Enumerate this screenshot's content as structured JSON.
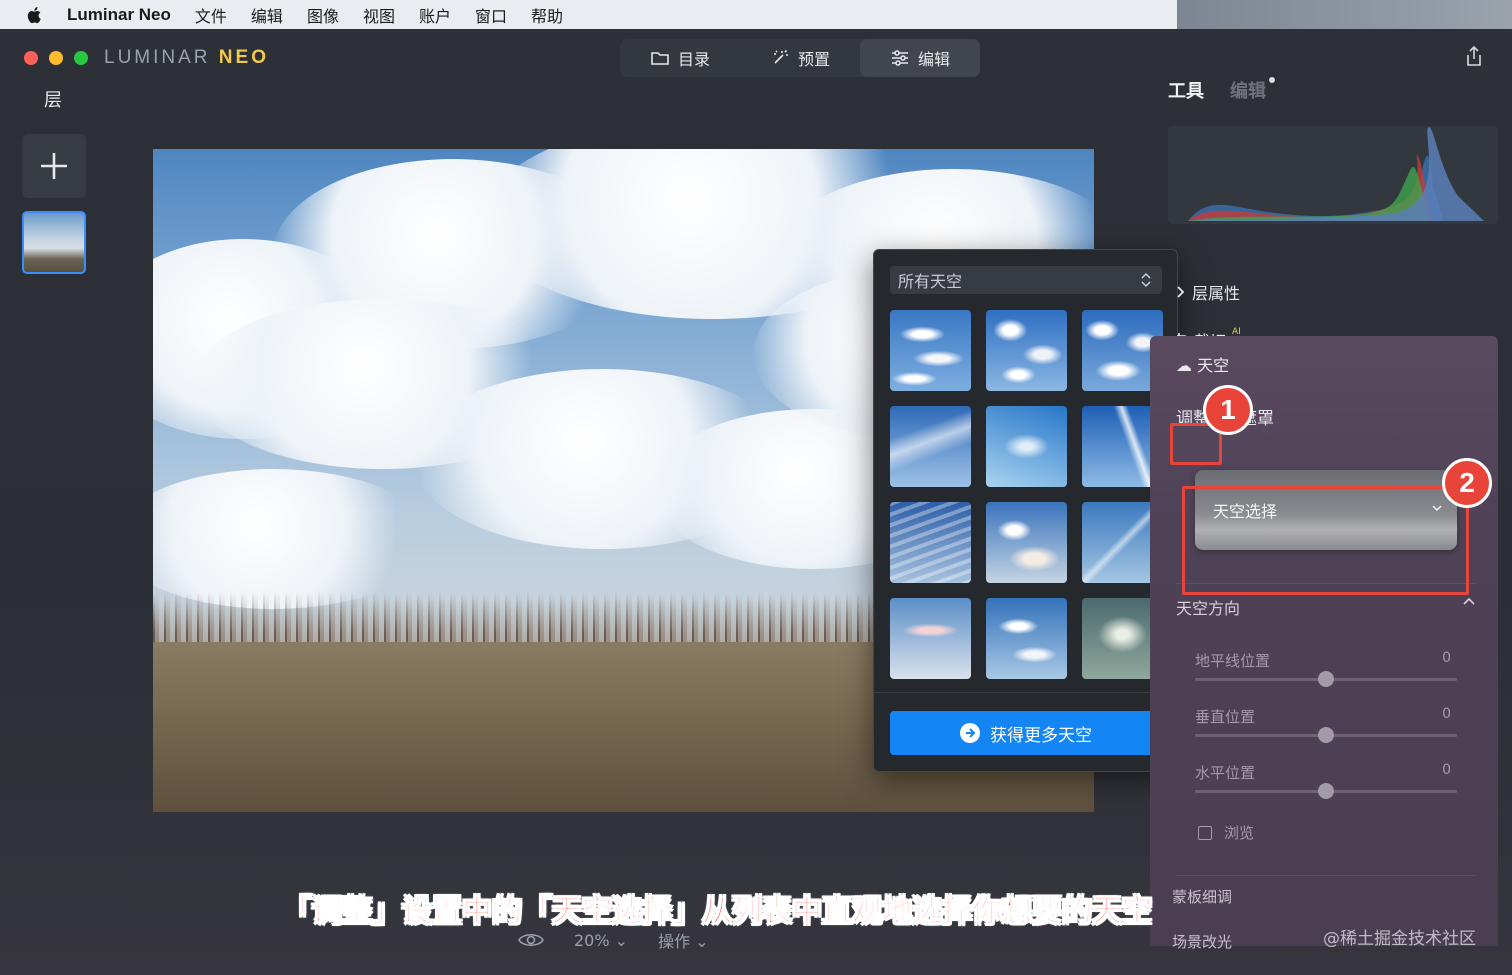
{
  "menubar": {
    "app": "Luminar Neo",
    "items": [
      "文件",
      "编辑",
      "图像",
      "视图",
      "账户",
      "窗口",
      "帮助"
    ]
  },
  "logo": {
    "part1": "LUMINAR",
    "part2": "NEO"
  },
  "topnav": {
    "catalog": "目录",
    "presets": "预置",
    "edit": "编辑"
  },
  "layers": {
    "title": "层"
  },
  "right_panel": {
    "tab_tools": "工具",
    "tab_edits": "编辑",
    "layer_properties": "层属性",
    "crop": "裁切",
    "crop_badge": "AI",
    "sky_tool": "天空",
    "sub_tabs": {
      "adjust": "调整",
      "mask": "遮罩"
    },
    "sky_selection": "天空选择",
    "sky_orientation": "天空方向",
    "sliders": [
      {
        "label": "地平线位置",
        "value": "0",
        "position": 0.5
      },
      {
        "label": "垂直位置",
        "value": "0",
        "position": 0.5
      },
      {
        "label": "水平位置",
        "value": "0",
        "position": 0.5
      }
    ],
    "browse": "浏览",
    "mask_refine": "蒙板细调",
    "scene_relight": "场景改光"
  },
  "sky_popup": {
    "filter": "所有天空",
    "get_more": "获得更多天空"
  },
  "bottombar": {
    "zoom": "20%",
    "actions": "操作"
  },
  "annotations": {
    "badge1": "1",
    "badge2": "2",
    "caption": "「调整」设置中的「天空选择」从列表中直观地选择你想要的天空",
    "watermark": "@稀土掘金技术社区"
  },
  "colors": {
    "accent_blue": "#1485f5",
    "annotation_red": "#e8443a",
    "logo_neo": "#f2c94c"
  }
}
